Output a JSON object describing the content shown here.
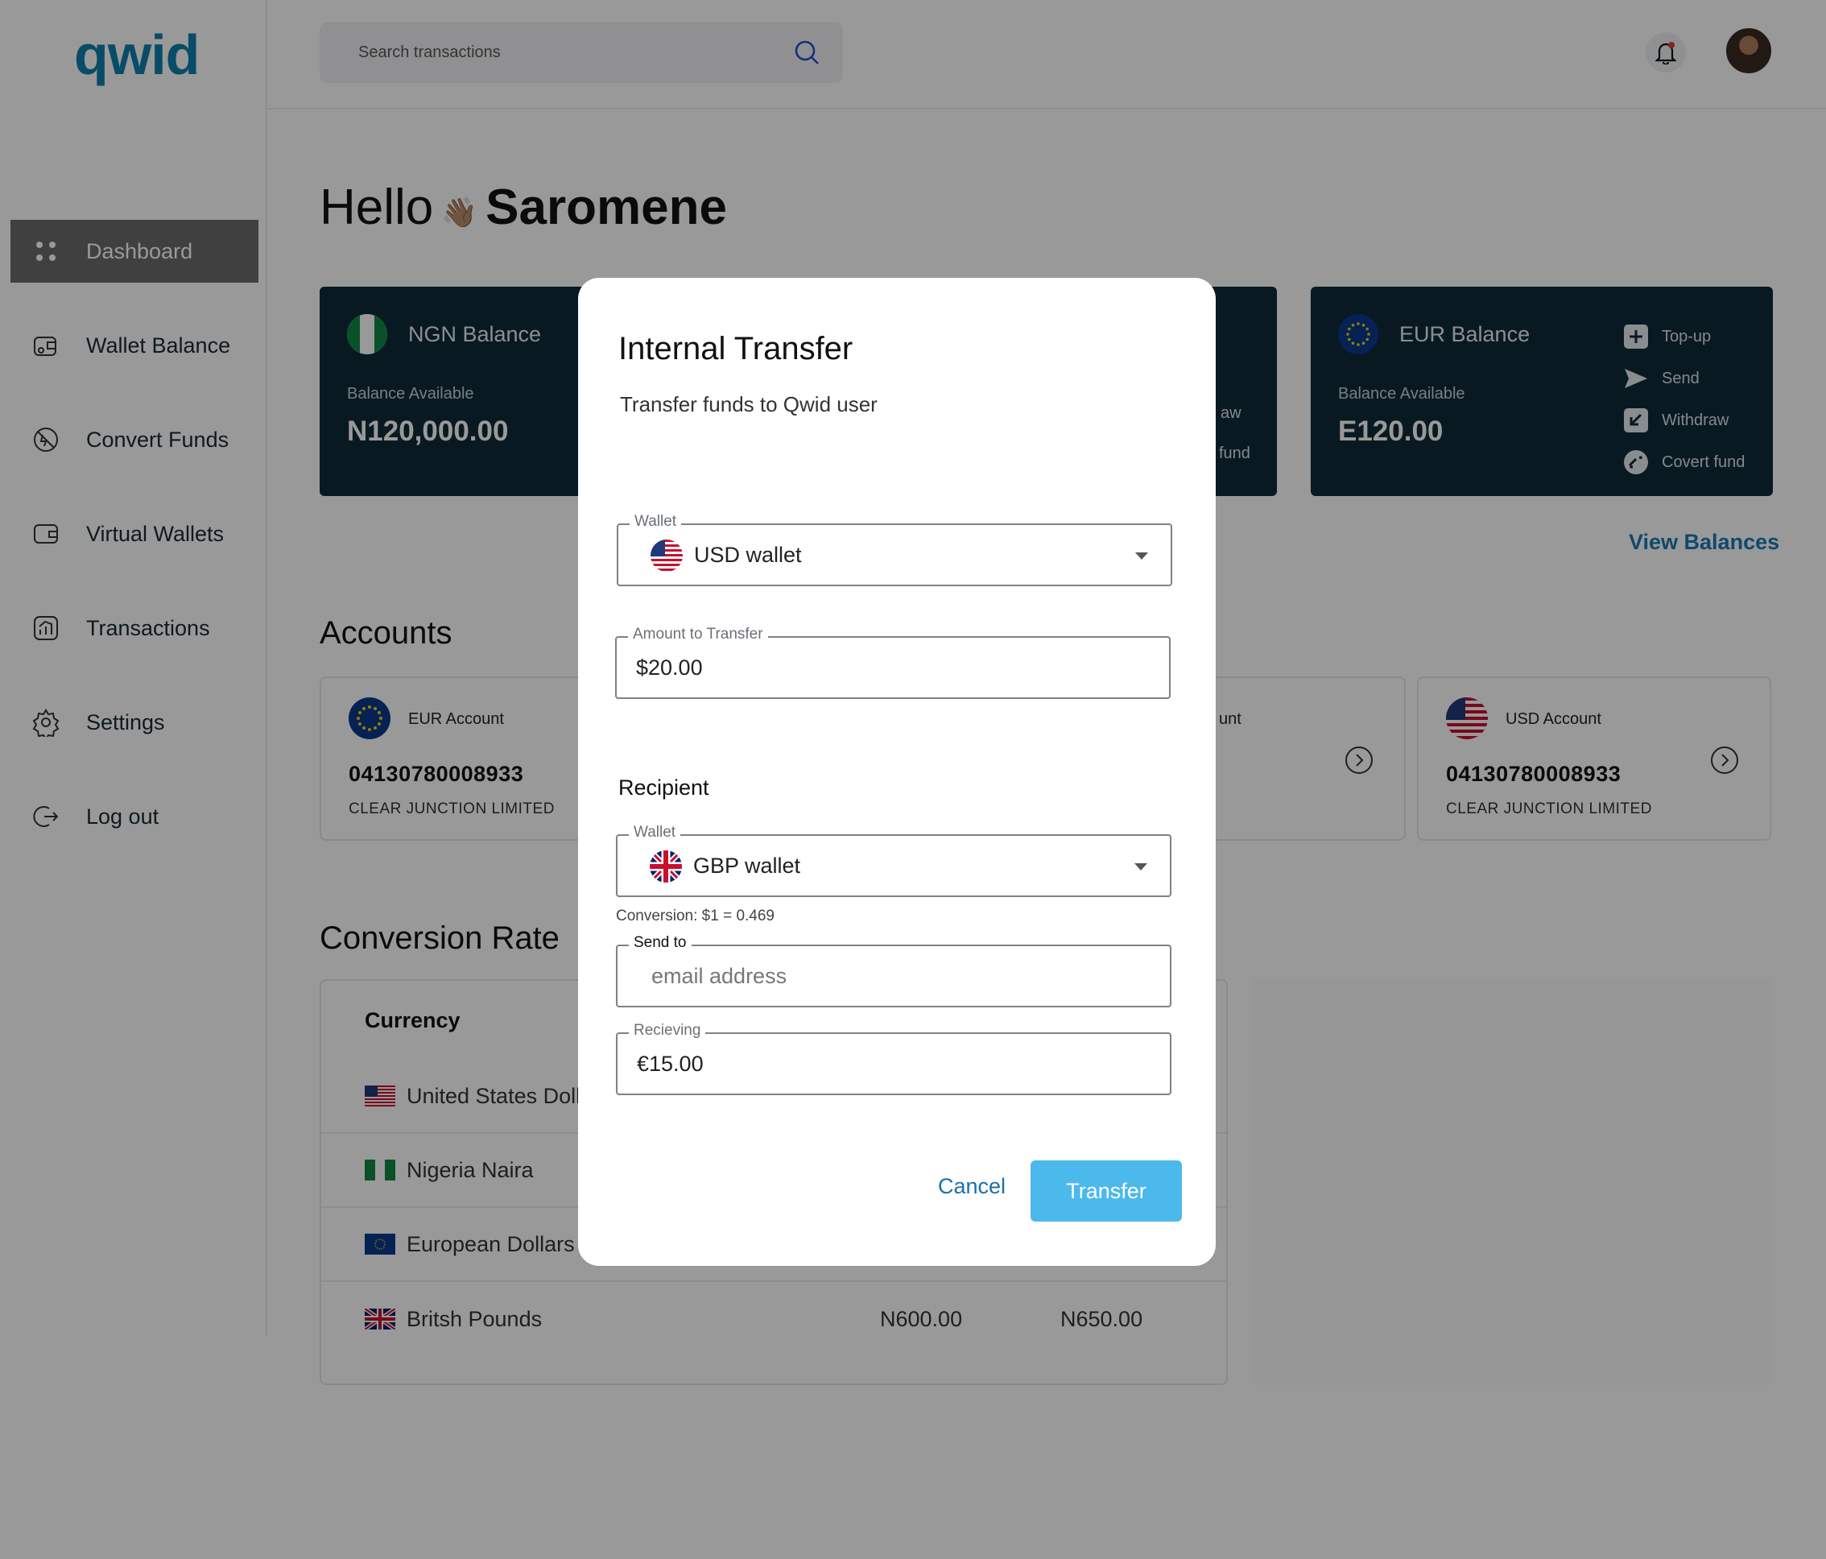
{
  "app": {
    "logo": "qwid"
  },
  "search": {
    "placeholder": "Search transactions"
  },
  "sidebar": {
    "items": [
      {
        "label": "Dashboard",
        "icon": "grid-icon",
        "active": true
      },
      {
        "label": "Wallet Balance",
        "icon": "wallet-icon"
      },
      {
        "label": "Convert Funds",
        "icon": "convert-icon"
      },
      {
        "label": "Virtual Wallets",
        "icon": "virtual-wallet-icon"
      },
      {
        "label": "Transactions",
        "icon": "chart-icon"
      },
      {
        "label": "Settings",
        "icon": "gear-icon"
      },
      {
        "label": "Log out",
        "icon": "logout-icon"
      }
    ]
  },
  "greeting": {
    "hello": "Hello",
    "wave": "👋🏽",
    "name": "Saromene"
  },
  "balances": {
    "ngn": {
      "title": "NGN Balance",
      "sub": "Balance Available",
      "amount": "N120,000.00"
    },
    "middle": {
      "partial_1": "aw",
      "partial_2": "fund"
    },
    "eur": {
      "title": "EUR Balance",
      "sub": "Balance Available",
      "amount": "E120.00",
      "actions": [
        "Top-up",
        "Send",
        "Withdraw",
        "Covert fund"
      ]
    },
    "view_link": "View Balances"
  },
  "accounts": {
    "heading": "Accounts",
    "items": [
      {
        "name": "EUR Account",
        "number": "04130780008933",
        "bank": "CLEAR JUNCTION LIMITED"
      },
      {
        "partial_name": "unt"
      },
      {
        "name": "USD Account",
        "number": "04130780008933",
        "bank": "CLEAR JUNCTION LIMITED"
      }
    ]
  },
  "conversion_rate": {
    "heading": "Conversion Rate",
    "column_header": "Currency",
    "rows": [
      {
        "currency": "United States Doll",
        "flag": "us"
      },
      {
        "currency": "Nigeria Naira",
        "flag": "ng"
      },
      {
        "currency": "European Dollars",
        "flag": "eu"
      },
      {
        "currency": "Britsh Pounds",
        "flag": "gb",
        "buy": "N600.00",
        "sell": "N650.00"
      }
    ]
  },
  "modal": {
    "title": "Internal Transfer",
    "subtitle": "Transfer funds to Qwid user",
    "wallet_from": {
      "legend": "Wallet",
      "value": "USD wallet",
      "flag": "us"
    },
    "amount": {
      "legend": "Amount to Transfer",
      "value": "$20.00"
    },
    "recipient_heading": "Recipient",
    "wallet_to": {
      "legend": "Wallet",
      "value": "GBP wallet",
      "flag": "gb"
    },
    "conversion_note": "Conversion: $1 = 0.469",
    "send_to": {
      "legend": "Send to",
      "placeholder": "email address"
    },
    "receiving": {
      "legend": "Recieving",
      "value": "€15.00"
    },
    "cancel_label": "Cancel",
    "transfer_label": "Transfer"
  },
  "colors": {
    "accent": "#4cb9ec",
    "card": "#0f2a3a",
    "brand": "#0e7fae",
    "link": "#1b78b8"
  }
}
